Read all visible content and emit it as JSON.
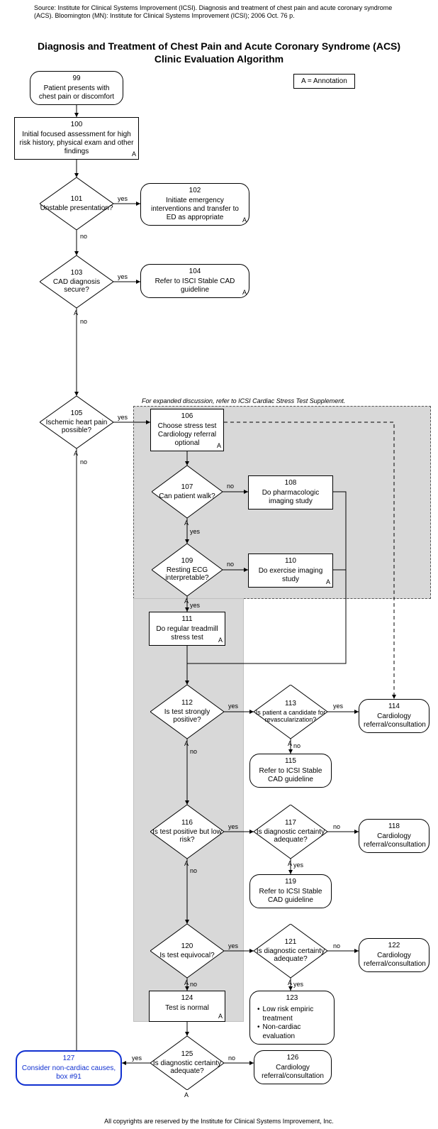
{
  "source": "Source: Institute for Clinical Systems Improvement (ICSI). Diagnosis and treatment of chest pain and acute coronary syndrome (ACS). Bloomington (MN): Institute for Clinical Systems Improvement (ICSI); 2006 Oct. 76 p.",
  "title_l1": "Diagnosis and Treatment of Chest Pain and Acute Coronary Syndrome (ACS)",
  "title_l2": "Clinic Evaluation Algorithm",
  "legend": "A = Annotation",
  "footer": "All copyrights are reserved by the Institute for Clinical Systems Improvement, Inc.",
  "stress_note": "For expanded discussion, refer to ICSI Cardiac Stress Test Supplement.",
  "edge": {
    "yes": "yes",
    "no": "no"
  },
  "n99": {
    "num": "99",
    "t": "Patient presents with chest pain or discomfort"
  },
  "n100": {
    "num": "100",
    "t": "Initial focused assessment for high risk history, physical exam and other findings",
    "a": "A"
  },
  "n101": {
    "num": "101",
    "t": "Unstable presentation?"
  },
  "n102": {
    "num": "102",
    "t": "Initiate emergency interventions and transfer to ED as appropriate",
    "a": "A"
  },
  "n103": {
    "num": "103",
    "t": "CAD diagnosis secure?",
    "a": "A"
  },
  "n104": {
    "num": "104",
    "t": "Refer to ISCI Stable CAD guideline",
    "a": "A"
  },
  "n105": {
    "num": "105",
    "t": "Ischemic heart pain possible?",
    "a": "A"
  },
  "n106": {
    "num": "106",
    "t": "Choose stress test Cardiology referral optional",
    "a": "A"
  },
  "n107": {
    "num": "107",
    "t": "Can patient walk?",
    "a": "A"
  },
  "n108": {
    "num": "108",
    "t": "Do pharmacologic imaging study"
  },
  "n109": {
    "num": "109",
    "t": "Resting ECG interpretable?",
    "a": "A"
  },
  "n110": {
    "num": "110",
    "t": "Do exercise imaging study",
    "a": "A"
  },
  "n111": {
    "num": "111",
    "t": "Do regular treadmill stress test",
    "a": "A"
  },
  "n112": {
    "num": "112",
    "t": "Is test strongly positive?",
    "a": "A"
  },
  "n113": {
    "num": "113",
    "t": "Is patient a candidate for revascularization?",
    "a": "A"
  },
  "n114": {
    "num": "114",
    "t": "Cardiology referral/consultation"
  },
  "n115": {
    "num": "115",
    "t": "Refer to ICSI Stable CAD guideline"
  },
  "n116": {
    "num": "116",
    "t": "Is test positive but low risk?",
    "a": "A"
  },
  "n117": {
    "num": "117",
    "t": "Is diagnostic certainty adequate?",
    "a": "A"
  },
  "n118": {
    "num": "118",
    "t": "Cardiology referral/consultation"
  },
  "n119": {
    "num": "119",
    "t": "Refer to ICSI Stable CAD guideline"
  },
  "n120": {
    "num": "120",
    "t": "Is test equivocal?",
    "a": "A"
  },
  "n121": {
    "num": "121",
    "t": "Is diagnostic certainty adequate?",
    "a": "A"
  },
  "n122": {
    "num": "122",
    "t": "Cardiology referral/consultation"
  },
  "n123": {
    "num": "123",
    "b1": "Low risk empiric treatment",
    "b2": "Non-cardiac evaluation"
  },
  "n124": {
    "num": "124",
    "t": "Test is normal",
    "a": "A"
  },
  "n125": {
    "num": "125",
    "t": "Is diagnostic certainty adequate?",
    "a": "A"
  },
  "n126": {
    "num": "126",
    "t": "Cardiology referral/consultation"
  },
  "n127": {
    "num": "127",
    "t": "Consider non-cardiac causes, box #91"
  }
}
